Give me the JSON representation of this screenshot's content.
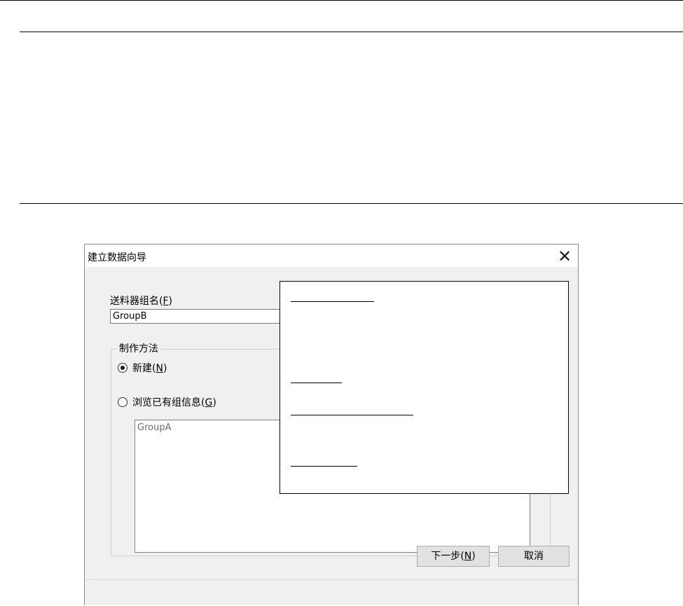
{
  "dialog": {
    "title": "建立数据向导",
    "close_glyph": "✕",
    "name_label_prefix": "送料器组名(",
    "name_label_key": "F",
    "name_label_suffix": ")",
    "name_value": "GroupB",
    "method_group_label": "制作方法",
    "option_new": {
      "label_prefix": "新建(",
      "key": "N",
      "label_suffix": ")",
      "selected": true
    },
    "option_browse": {
      "label_prefix": "浏览已有组信息(",
      "key": "G",
      "label_suffix": ")",
      "selected": false
    },
    "existing_groups": [
      "GroupA"
    ],
    "next_button": {
      "label_prefix": "下一步(",
      "key": "N",
      "label_suffix": ")"
    },
    "cancel_button": "取消"
  }
}
